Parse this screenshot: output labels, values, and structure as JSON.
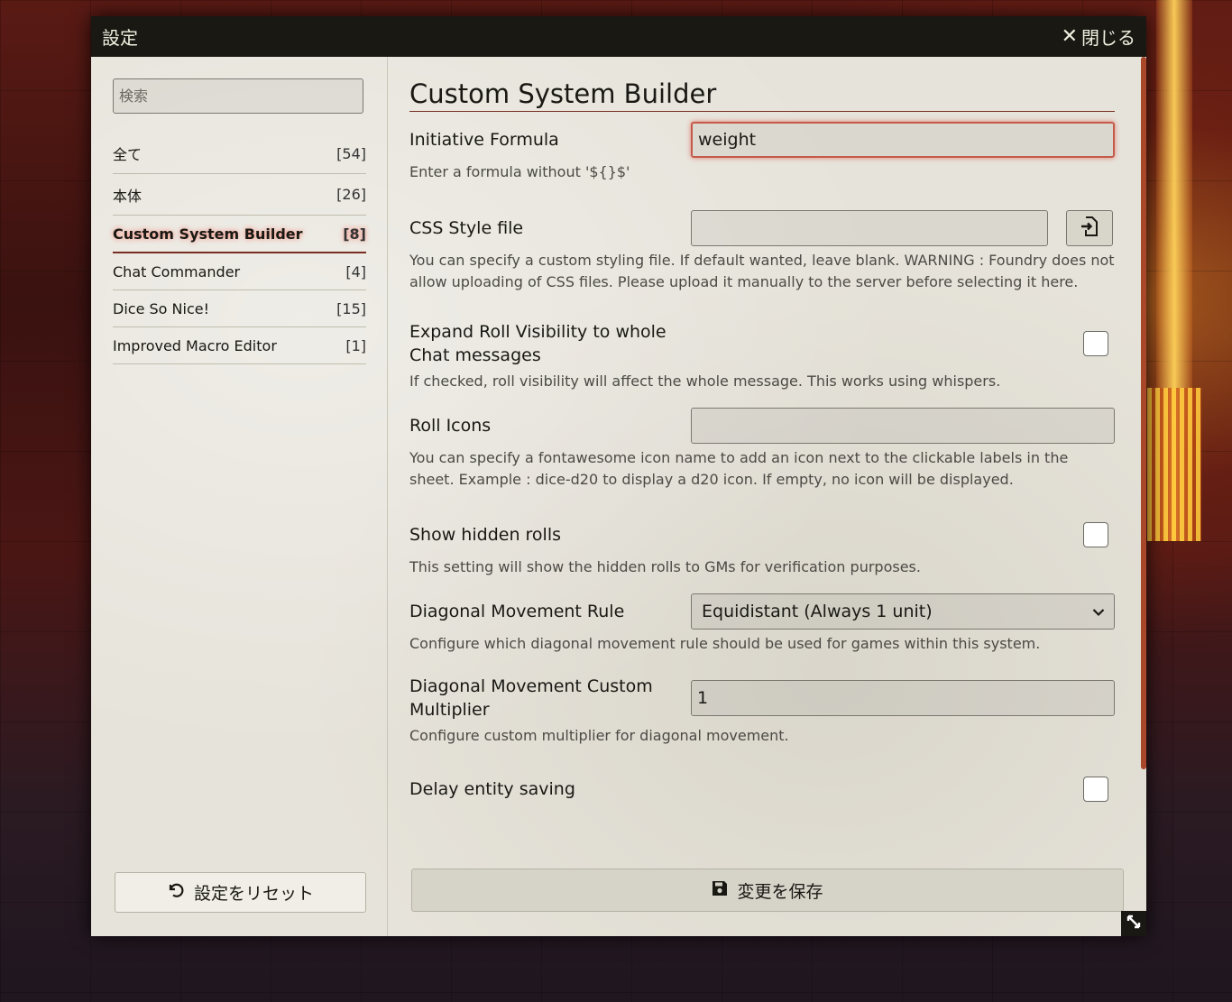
{
  "window": {
    "title": "設定",
    "close_label": "閉じる"
  },
  "sidebar": {
    "search_placeholder": "検索",
    "categories": [
      {
        "label": "全て",
        "count": "[54]"
      },
      {
        "label": "本体",
        "count": "[26]"
      },
      {
        "label": "Custom System Builder",
        "count": "[8]"
      },
      {
        "label": "Chat Commander",
        "count": "[4]"
      },
      {
        "label": "Dice So Nice!",
        "count": "[15]"
      },
      {
        "label": "Improved Macro Editor",
        "count": "[1]"
      }
    ],
    "reset_label": "設定をリセット"
  },
  "main": {
    "section_title": "Custom System Builder",
    "settings": {
      "initiative": {
        "label": "Initiative Formula",
        "value": "weight",
        "hint": "Enter a formula without '${}$'"
      },
      "css": {
        "label": "CSS Style file",
        "value": "",
        "hint": "You can specify a custom styling file. If default wanted, leave blank. WARNING : Foundry does not allow uploading of CSS files. Please upload it manually to the server before selecting it here."
      },
      "expand": {
        "label": "Expand Roll Visibility to whole Chat messages",
        "hint": "If checked, roll visibility will affect the whole message. This works using whispers."
      },
      "roll_icons": {
        "label": "Roll Icons",
        "value": "",
        "hint": "You can specify a fontawesome icon name to add an icon next to the clickable labels in the sheet. Example : dice-d20 to display a d20 icon. If empty, no icon will be displayed."
      },
      "hidden_rolls": {
        "label": "Show hidden rolls",
        "hint": "This setting will show the hidden rolls to GMs for verification purposes."
      },
      "diagonal_rule": {
        "label": "Diagonal Movement Rule",
        "value": "Equidistant (Always 1 unit)",
        "hint": "Configure which diagonal movement rule should be used for games within this system."
      },
      "diagonal_mult": {
        "label": "Diagonal Movement Custom Multiplier",
        "value": "1",
        "hint": "Configure custom multiplier for diagonal movement."
      },
      "delay_saving": {
        "label": "Delay entity saving"
      }
    },
    "save_label": "変更を保存"
  },
  "icons": {
    "close": "close-icon",
    "reset": "undo-icon",
    "file": "file-import-icon",
    "save": "floppy-disk-icon",
    "chevron": "chevron-down-icon",
    "resize": "resize-icon"
  }
}
